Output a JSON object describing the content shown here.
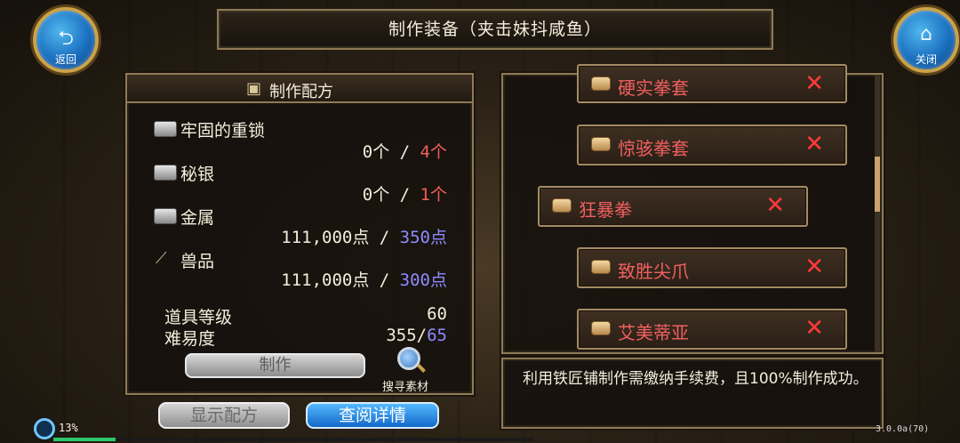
{
  "title": "制作装备（夹击妹抖咸鱼）",
  "back_button": {
    "icon": "⮌",
    "label": "返回"
  },
  "close_button": {
    "icon": "⌂",
    "label": "关闭"
  },
  "recipe": {
    "header": "制作配方",
    "materials": [
      {
        "name": "牢固的重锁",
        "have": "0个",
        "sep": " / ",
        "need": "4个",
        "need_color": "red"
      },
      {
        "name": "秘银",
        "have": "0个",
        "sep": " / ",
        "need": "1个",
        "need_color": "red"
      },
      {
        "name": "金属",
        "have": "111,000点",
        "sep": " / ",
        "need": "350点",
        "need_color": "blue"
      },
      {
        "name": "兽品",
        "have": "111,000点",
        "sep": " / ",
        "need": "300点",
        "need_color": "blue"
      }
    ],
    "item_level_label": "道具等级",
    "item_level_value": "60",
    "difficulty_label": "难易度",
    "difficulty_current": "355/",
    "difficulty_required": "65",
    "craft_button": "制作",
    "search_label": "搜寻素材"
  },
  "buttons": {
    "show_recipe": "显示配方",
    "view_details": "查阅详情"
  },
  "list": [
    {
      "label": "硬实拳套"
    },
    {
      "label": "惊骇拳套"
    },
    {
      "label": "狂暴拳"
    },
    {
      "label": "致胜尖爪"
    },
    {
      "label": "艾美蒂亚"
    }
  ],
  "description": "利用铁匠铺制作需缴纳手续费，且100%制作成功。",
  "status": {
    "progress_text": "13%",
    "progress_value": 0.13,
    "version": "3.0.0a(70)"
  },
  "colors": {
    "accent_gold": "#8f7a55",
    "need_red": "#f0605a",
    "need_blue": "#8c8cff",
    "item_red": "#f06060"
  }
}
